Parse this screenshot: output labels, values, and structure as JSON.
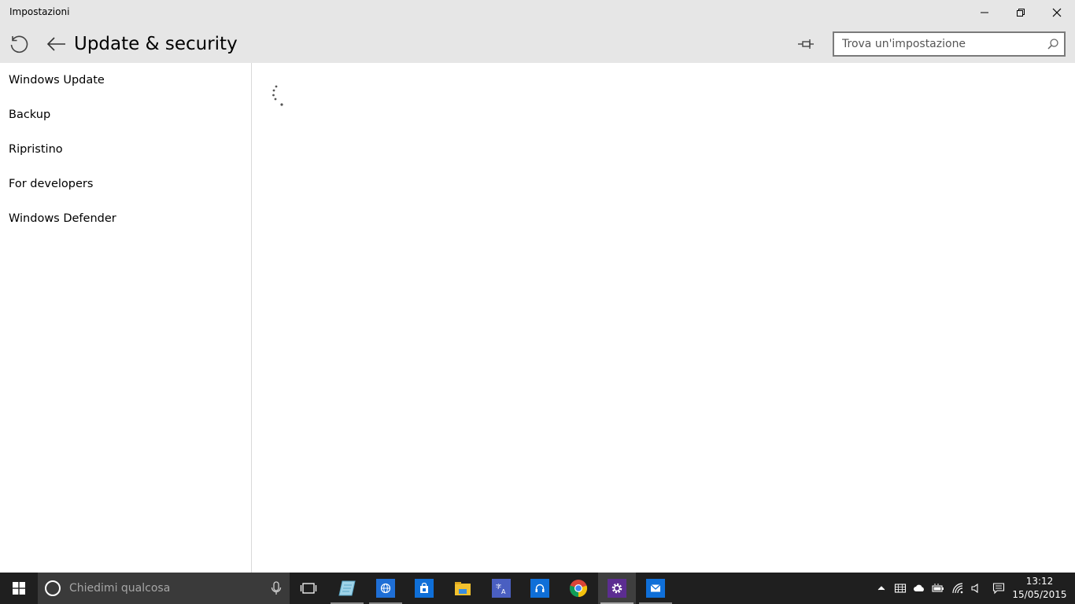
{
  "window": {
    "title": "Impostazioni"
  },
  "header": {
    "page_title": "Update & security",
    "search_placeholder": "Trova un'impostazione"
  },
  "sidebar": {
    "items": [
      {
        "label": "Windows Update"
      },
      {
        "label": "Backup"
      },
      {
        "label": "Ripristino"
      },
      {
        "label": "For developers"
      },
      {
        "label": "Windows Defender"
      }
    ]
  },
  "taskbar": {
    "cortana_placeholder": "Chiedimi qualcosa",
    "apps": [
      {
        "icon": "task-view-icon"
      },
      {
        "icon": "notepad-icon"
      },
      {
        "icon": "browser-icon",
        "color": "#1f6fd6"
      },
      {
        "icon": "store-icon",
        "color": "#0f6fd8"
      },
      {
        "icon": "file-explorer-icon",
        "color": "#f2c12e"
      },
      {
        "icon": "translator-icon",
        "color": "#4a5fc1"
      },
      {
        "icon": "music-icon",
        "color": "#0f6fd8"
      },
      {
        "icon": "chrome-icon"
      },
      {
        "icon": "settings-icon",
        "color": "#5c2d91"
      },
      {
        "icon": "mail-icon",
        "color": "#0f6fd8"
      }
    ],
    "clock": {
      "time": "13:12",
      "date": "15/05/2015"
    }
  },
  "colors": {
    "chrome_bg": "#e6e6e6",
    "taskbar_bg": "#1f1f1f",
    "cortana_bg": "#3a3a3a"
  }
}
